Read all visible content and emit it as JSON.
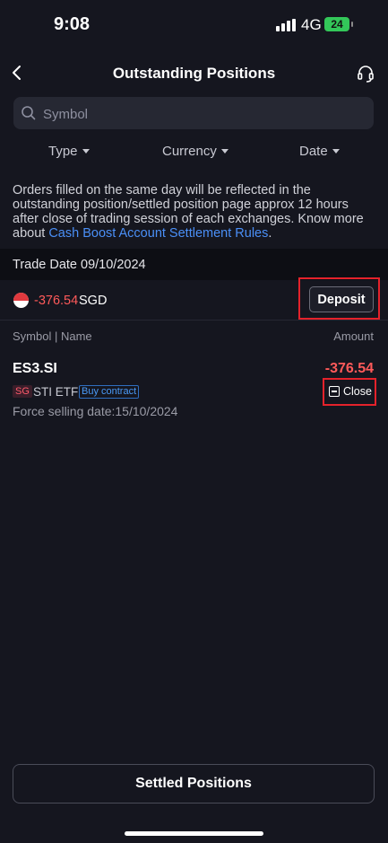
{
  "status_bar": {
    "time": "9:08",
    "network": "4G",
    "battery": "24"
  },
  "nav": {
    "title": "Outstanding Positions"
  },
  "search": {
    "placeholder": "Symbol"
  },
  "filters": {
    "type": "Type",
    "currency": "Currency",
    "date": "Date"
  },
  "info": {
    "text": "Orders filled on the same day will be reflected in the outstanding position/settled position page approx 12 hours after close of trading session of each exchanges.  Know more about ",
    "link": "Cash Boost Account Settlement Rules",
    "end": "."
  },
  "trade_date": "Trade Date 09/10/2024",
  "summary": {
    "amount": "-376.54",
    "currency": "SGD",
    "deposit_label": "Deposit"
  },
  "columns": {
    "left": "Symbol | Name",
    "right": "Amount"
  },
  "positions": [
    {
      "symbol": "ES3.SI",
      "amount": "-376.54",
      "market": "SG",
      "name": "STI ETF",
      "tag": "Buy contract",
      "force_selling": "Force selling date:15/10/2024",
      "close_label": "Close"
    }
  ],
  "footer": {
    "settled_label": "Settled Positions"
  },
  "colors": {
    "background": "#15161f",
    "negative": "#ff5a5a",
    "link": "#4a8ff7",
    "highlight": "#e4222b"
  }
}
